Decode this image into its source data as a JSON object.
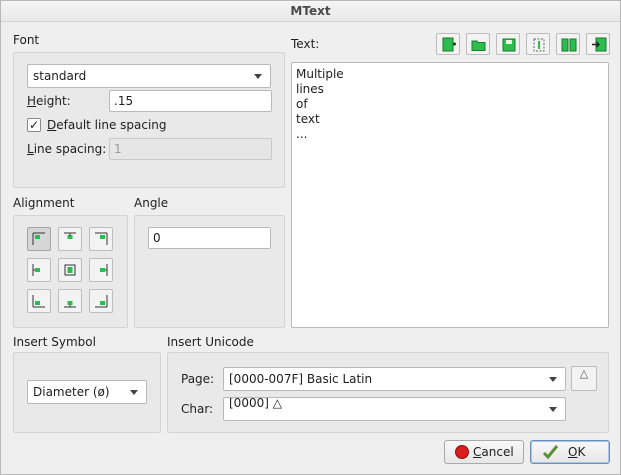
{
  "window": {
    "title": "MText"
  },
  "font": {
    "section_label": "Font",
    "font_name": "standard",
    "height_label": "Height:",
    "height_value": ".15",
    "default_spacing_label": "Default line spacing",
    "default_spacing_checked": true,
    "line_spacing_label": "Line spacing:",
    "line_spacing_value": "1"
  },
  "text": {
    "label": "Text:",
    "lines": [
      "Multiple",
      "lines",
      "of",
      "text",
      "..."
    ],
    "toolbar_icons": [
      "new-page-icon",
      "open-folder-icon",
      "save-disk-icon",
      "clear-icon",
      "book-icon",
      "import-icon"
    ]
  },
  "alignment": {
    "section_label": "Alignment",
    "buttons": [
      "align-top-left",
      "align-top-center",
      "align-top-right",
      "align-middle-left",
      "align-middle-center",
      "align-middle-right",
      "align-bottom-left",
      "align-bottom-center",
      "align-bottom-right"
    ],
    "selected": "align-top-left"
  },
  "angle": {
    "section_label": "Angle",
    "value": "0"
  },
  "insert_symbol": {
    "section_label": "Insert Symbol",
    "selected": "Diameter (ø)"
  },
  "insert_unicode": {
    "section_label": "Insert Unicode",
    "page_label": "Page:",
    "page_value": "[0000-007F] Basic Latin",
    "char_label": "Char:",
    "char_value": "[0000] △",
    "insert_glyph": "△"
  },
  "buttons": {
    "cancel": "Cancel",
    "ok": "OK"
  },
  "colors": {
    "accent_green": "#2bbd4e",
    "cancel_red": "#d81e1e",
    "ok_green": "#5f8f34"
  }
}
